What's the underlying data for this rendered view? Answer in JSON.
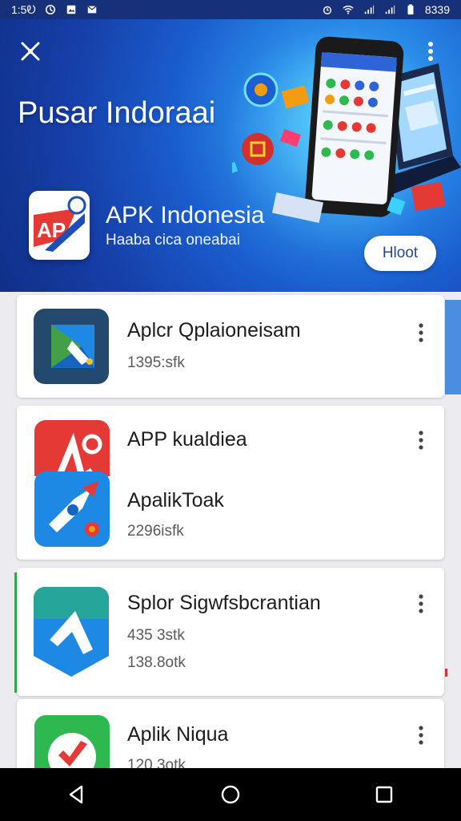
{
  "status_bar": {
    "time": "1:5Ꭷ",
    "battery": "8339",
    "icons": [
      "sync-icon",
      "photo-icon",
      "mail-icon",
      "alarm-icon",
      "wifi-icon",
      "signal-icon",
      "signal-icon",
      "battery-icon"
    ]
  },
  "hero": {
    "title": "Pusar Indoraai",
    "app_name": "APK Indonesia",
    "app_subtitle": "Haaba cica oneabai",
    "logo_text": "AP",
    "button_label": "Hloot",
    "colors": {
      "hero_dark": "#102f87",
      "hero_light": "#4fd4ff",
      "accent_red": "#e53935"
    }
  },
  "apps": [
    {
      "name": "Aplcr Qplaioneisam",
      "meta_lines": [
        "1395:sfk"
      ],
      "icon": "play-store-icon"
    },
    {
      "name": "APP kualdiea",
      "meta_lines": [],
      "icon": "apk-red-icon"
    },
    {
      "name": "ApalikToak",
      "meta_lines": [
        "2296isfk"
      ],
      "icon": "rocket-app-icon"
    },
    {
      "name": "Splor Sigwfsbcrantian",
      "meta_lines": [
        "435 3stk",
        "138.8otk"
      ],
      "icon": "green-blue-arrow-icon"
    },
    {
      "name": "Aplik Niqua",
      "meta_lines": [
        "120 3otk"
      ],
      "icon": "green-check-app-icon"
    }
  ],
  "nav": {
    "back": "back-icon",
    "home": "home-icon",
    "recents": "recents-icon"
  }
}
